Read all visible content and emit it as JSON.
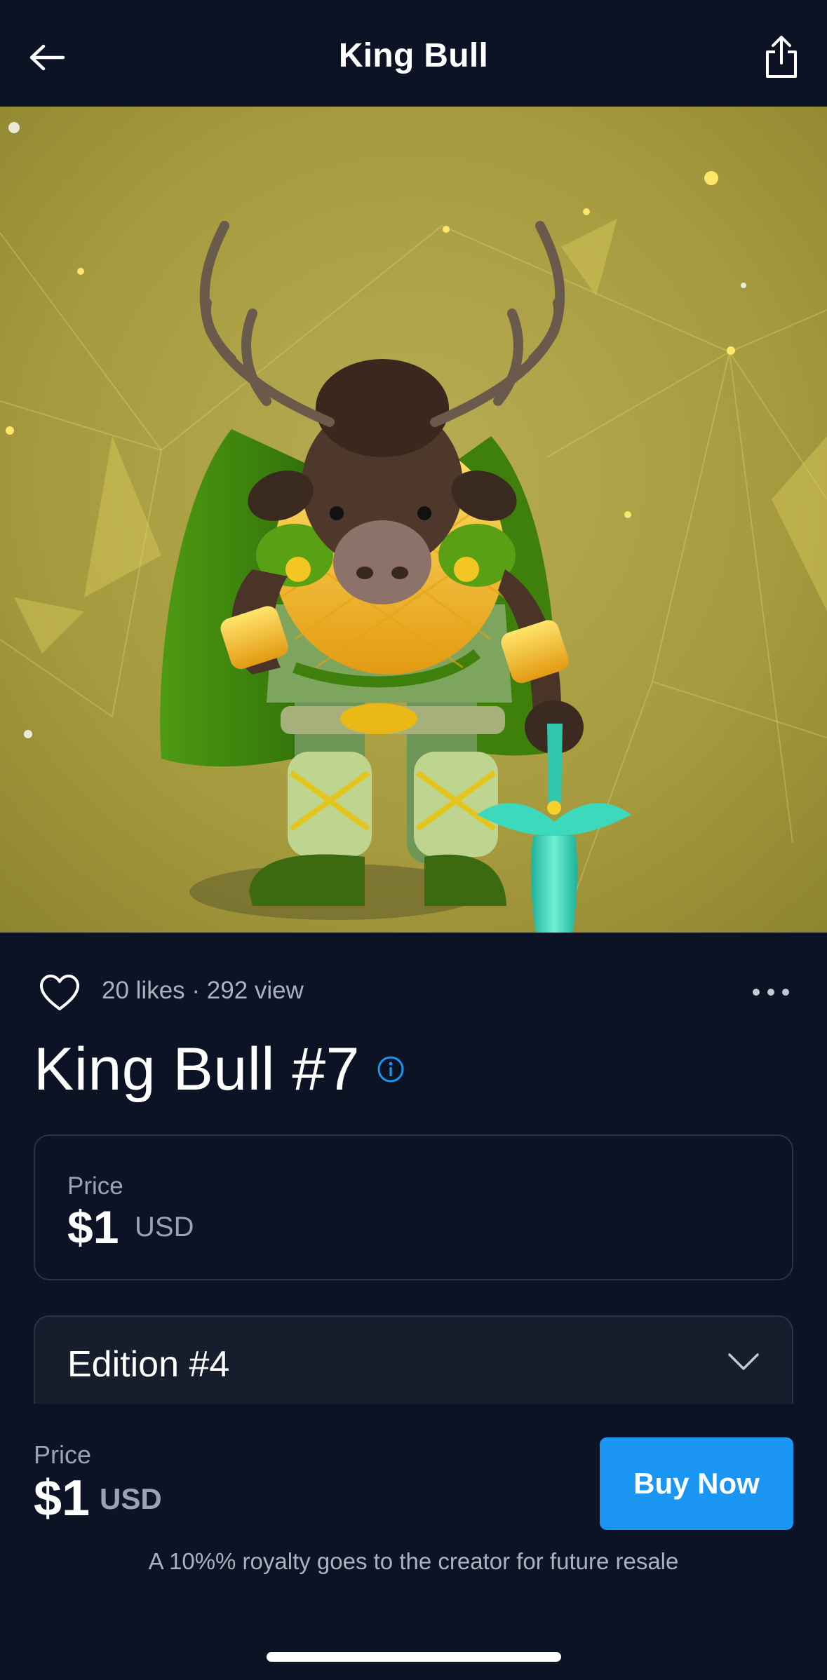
{
  "header": {
    "title": "King Bull",
    "back_icon": "arrow-left-icon",
    "share_icon": "share-icon"
  },
  "hero": {
    "description_icon": "nft-artwork"
  },
  "meta": {
    "like_icon": "heart-icon",
    "stats": "20 likes · 292 view",
    "more_icon": "more-horizontal-icon"
  },
  "nft": {
    "title": "King Bull #7",
    "info_icon": "info-icon"
  },
  "price_card": {
    "label": "Price",
    "amount": "$1",
    "currency": "USD"
  },
  "edition": {
    "selected": "Edition #4",
    "chevron_icon": "chevron-down-icon"
  },
  "bottom_bar": {
    "label": "Price",
    "amount": "$1",
    "currency": "USD",
    "buy_label": "Buy Now",
    "royalty_note": "A 10%% royalty goes to the creator for future resale"
  },
  "colors": {
    "background": "#0c1324",
    "accent": "#1a96f2",
    "card_border": "#2a3344",
    "muted_text": "#9aa3b2"
  }
}
